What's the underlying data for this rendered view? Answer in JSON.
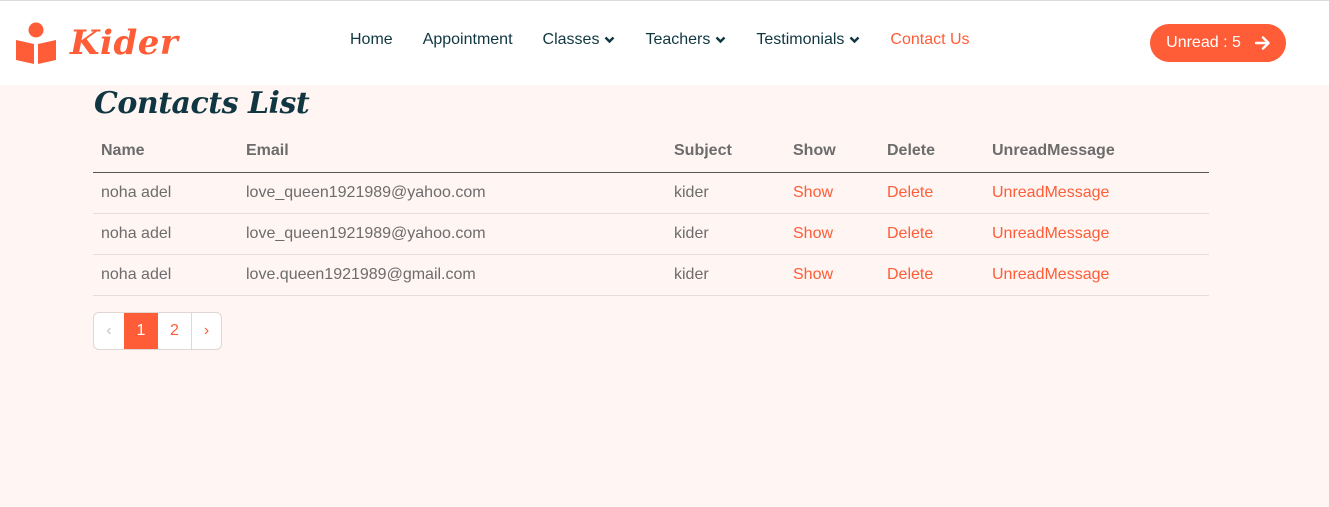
{
  "brand": {
    "name": "Kider"
  },
  "nav": {
    "items": [
      {
        "label": "Home"
      },
      {
        "label": "Appointment"
      },
      {
        "label": "Classes"
      },
      {
        "label": "Teachers"
      },
      {
        "label": "Testimonials"
      },
      {
        "label": "Contact Us"
      }
    ],
    "active": "Contact Us",
    "unread_label": "Unread : 5"
  },
  "main": {
    "title": "Contacts List",
    "table": {
      "headers": [
        "Name",
        "Email",
        "Subject",
        "Show",
        "Delete",
        "UnreadMessage"
      ],
      "rows": [
        [
          "noha adel",
          "love_queen1921989@yahoo.com",
          "kider",
          "Show",
          "Delete",
          "UnreadMessage"
        ],
        [
          "noha adel",
          "love_queen1921989@yahoo.com",
          "kider",
          "Show",
          "Delete",
          "UnreadMessage"
        ],
        [
          "noha adel",
          "love.queen1921989@gmail.com",
          "kider",
          "Show",
          "Delete",
          "UnreadMessage"
        ]
      ]
    },
    "pagination": {
      "prev": "‹",
      "pages": [
        "1",
        "2"
      ],
      "current": "1",
      "next": "›"
    }
  },
  "colors": {
    "accent": "#FE5D37",
    "dark": "#103741",
    "background": "#FFF5F3"
  }
}
